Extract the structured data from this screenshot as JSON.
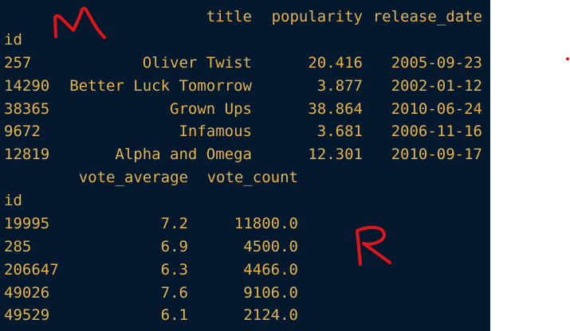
{
  "table1": {
    "headers": {
      "title": "title",
      "popularity": "popularity",
      "release_date": "release_date"
    },
    "index_name": "id",
    "rows": [
      {
        "id": "257",
        "title": "Oliver Twist",
        "popularity": "20.416",
        "release_date": "2005-09-23"
      },
      {
        "id": "14290",
        "title": "Better Luck Tomorrow",
        "popularity": "3.877",
        "release_date": "2002-01-12"
      },
      {
        "id": "38365",
        "title": "Grown Ups",
        "popularity": "38.864",
        "release_date": "2010-06-24"
      },
      {
        "id": "9672",
        "title": "Infamous",
        "popularity": "3.681",
        "release_date": "2006-11-16"
      },
      {
        "id": "12819",
        "title": "Alpha and Omega",
        "popularity": "12.301",
        "release_date": "2010-09-17"
      }
    ]
  },
  "table2": {
    "headers": {
      "vote_average": "vote_average",
      "vote_count": "vote_count"
    },
    "index_name": "id",
    "rows": [
      {
        "id": "19995",
        "vote_average": "7.2",
        "vote_count": "11800.0"
      },
      {
        "id": "285",
        "vote_average": "6.9",
        "vote_count": "4500.0"
      },
      {
        "id": "206647",
        "vote_average": "6.3",
        "vote_count": "4466.0"
      },
      {
        "id": "49026",
        "vote_average": "7.6",
        "vote_count": "9106.0"
      },
      {
        "id": "49529",
        "vote_average": "6.1",
        "vote_count": "2124.0"
      }
    ]
  },
  "annotations": {
    "handwritten_m": "M",
    "handwritten_r": "R",
    "ink_color": "#e0151b"
  },
  "colors": {
    "background": "#04192d",
    "text": "#e5b34a",
    "page": "#ffffff"
  }
}
